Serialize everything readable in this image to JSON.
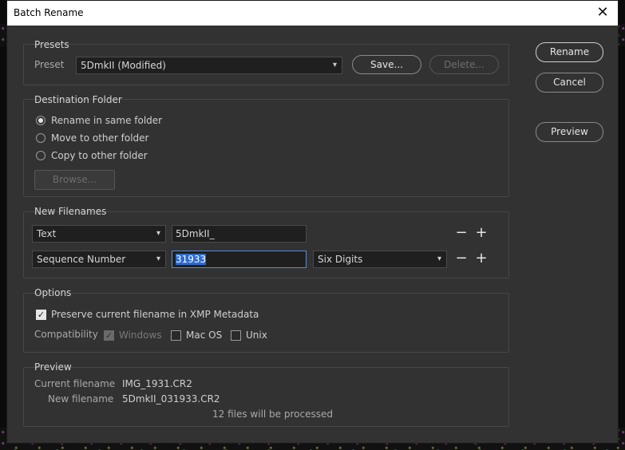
{
  "window": {
    "title": "Batch Rename"
  },
  "presets": {
    "group_label": "Presets",
    "preset_label": "Preset",
    "preset_value": "5DmkII (Modified)",
    "save_label": "Save...",
    "delete_label": "Delete..."
  },
  "destination": {
    "group_label": "Destination Folder",
    "options": [
      "Rename in same folder",
      "Move to other folder",
      "Copy to other folder"
    ],
    "selected_index": 0,
    "browse_label": "Browse..."
  },
  "filenames": {
    "group_label": "New Filenames",
    "rows": [
      {
        "type": "Text",
        "value": "5DmkII_"
      },
      {
        "type": "Sequence Number",
        "value": "31933",
        "digits": "Six Digits"
      }
    ]
  },
  "options": {
    "group_label": "Options",
    "preserve_label": "Preserve current filename in XMP Metadata",
    "compat_label": "Compatibility",
    "windows_label": "Windows",
    "macos_label": "Mac OS",
    "unix_label": "Unix"
  },
  "preview": {
    "group_label": "Preview",
    "current_label": "Current filename",
    "current_value": "IMG_1931.CR2",
    "new_label": "New filename",
    "new_value": "5DmkII_031933.CR2",
    "files_note": "12 files will be processed"
  },
  "actions": {
    "rename_label": "Rename",
    "cancel_label": "Cancel",
    "preview_label": "Preview"
  }
}
